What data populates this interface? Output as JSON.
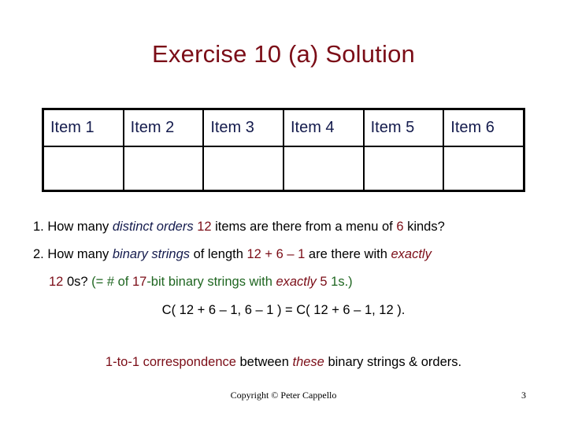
{
  "slide": {
    "title": "Exercise 10 (a) Solution"
  },
  "table": {
    "header_cells": [
      "Item 1",
      "Item 2",
      "Item 3",
      "Item 4",
      "Item 5",
      "Item 6"
    ],
    "empty_cells": [
      "",
      "",
      "",
      "",
      "",
      ""
    ]
  },
  "body": {
    "line1": {
      "p1": "1. How many ",
      "p2": "distinct orders",
      "p3": " ",
      "p4": "12",
      "p5": " items are there from a menu of ",
      "p6": "6",
      "p7": " kinds?"
    },
    "line2": {
      "p1": "2. How many ",
      "p2": "binary strings",
      "p3": " of length ",
      "p4": "12 + 6 – 1",
      "p5": " are there with ",
      "p6": "exactly"
    },
    "line3": {
      "p1": "12",
      "p2": " 0s?",
      "p3": "  (= # of ",
      "p4": "17",
      "p5": "-bit binary strings with ",
      "p6": "exactly",
      "p7": " 5",
      "p8": " 1s.)"
    },
    "line4": {
      "p1": "C( 12 + 6 – 1, 6 – 1 ) = C( 12 + 6 – 1, 12 )."
    },
    "line5": {
      "p1": "1-to-1 correspondence",
      "p2": " between ",
      "p3": "these",
      "p4": " binary strings & orders."
    }
  },
  "footer": {
    "copyright": "Copyright © Peter Cappello",
    "page_number": "3"
  },
  "colors": {
    "title_red": "#7B0D17",
    "navy": "#141B4D",
    "green": "#1F6621",
    "black": "#000000",
    "background": "#FFFFFF"
  }
}
